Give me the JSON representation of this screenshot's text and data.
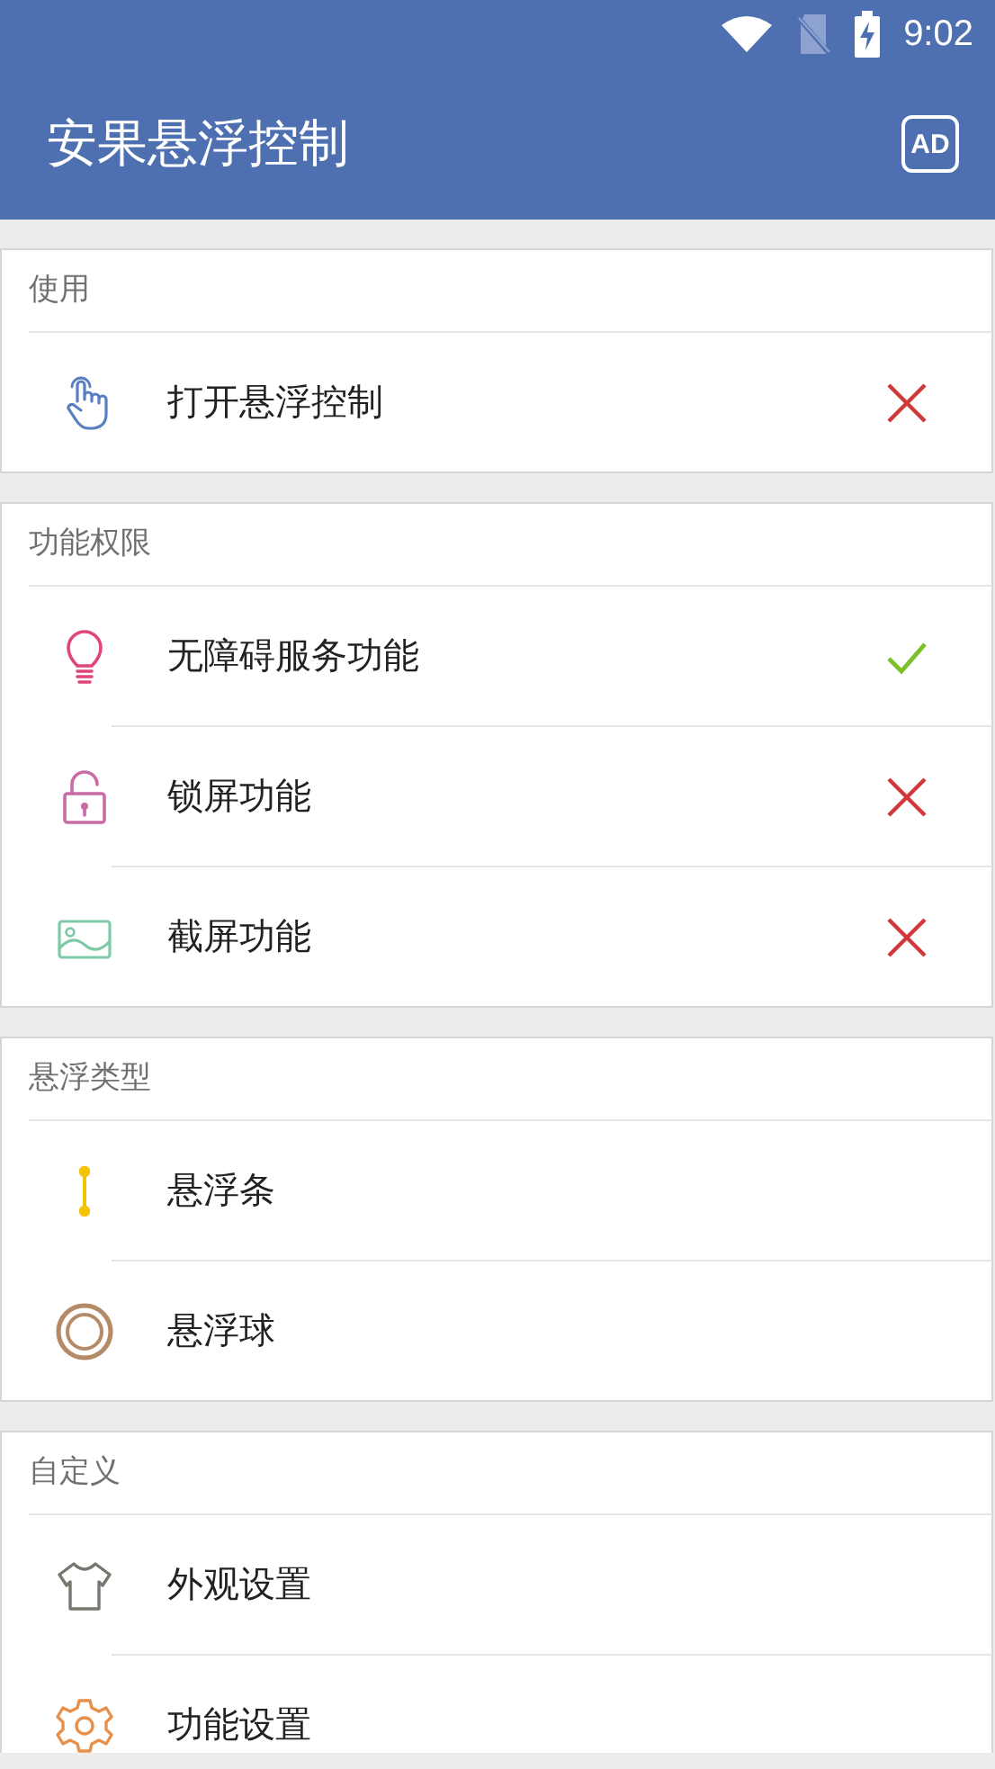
{
  "status_bar": {
    "time": "9:02"
  },
  "app_bar": {
    "title": "安果悬浮控制",
    "action": "AD"
  },
  "sections": [
    {
      "title": "使用",
      "items": [
        {
          "label": "打开悬浮控制",
          "kind": "touch",
          "granted": false
        }
      ]
    },
    {
      "title": "功能权限",
      "items": [
        {
          "label": "无障碍服务功能",
          "kind": "bulb",
          "granted": true
        },
        {
          "label": "锁屏功能",
          "kind": "lock",
          "granted": false
        },
        {
          "label": "截屏功能",
          "kind": "image",
          "granted": false
        }
      ]
    },
    {
      "title": "悬浮类型",
      "items": [
        {
          "label": "悬浮条",
          "kind": "bar"
        },
        {
          "label": "悬浮球",
          "kind": "ball"
        }
      ]
    },
    {
      "title": "自定义",
      "items": [
        {
          "label": "外观设置",
          "kind": "shirt"
        },
        {
          "label": "功能设置",
          "kind": "gear"
        }
      ]
    }
  ]
}
